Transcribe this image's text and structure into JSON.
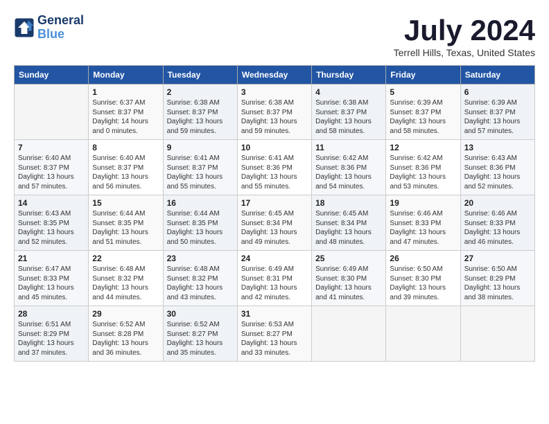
{
  "header": {
    "logo_line1": "General",
    "logo_line2": "Blue",
    "month_year": "July 2024",
    "location": "Terrell Hills, Texas, United States"
  },
  "days_of_week": [
    "Sunday",
    "Monday",
    "Tuesday",
    "Wednesday",
    "Thursday",
    "Friday",
    "Saturday"
  ],
  "weeks": [
    [
      {
        "day": "",
        "info": ""
      },
      {
        "day": "1",
        "info": "Sunrise: 6:37 AM\nSunset: 8:37 PM\nDaylight: 14 hours\nand 0 minutes."
      },
      {
        "day": "2",
        "info": "Sunrise: 6:38 AM\nSunset: 8:37 PM\nDaylight: 13 hours\nand 59 minutes."
      },
      {
        "day": "3",
        "info": "Sunrise: 6:38 AM\nSunset: 8:37 PM\nDaylight: 13 hours\nand 59 minutes."
      },
      {
        "day": "4",
        "info": "Sunrise: 6:38 AM\nSunset: 8:37 PM\nDaylight: 13 hours\nand 58 minutes."
      },
      {
        "day": "5",
        "info": "Sunrise: 6:39 AM\nSunset: 8:37 PM\nDaylight: 13 hours\nand 58 minutes."
      },
      {
        "day": "6",
        "info": "Sunrise: 6:39 AM\nSunset: 8:37 PM\nDaylight: 13 hours\nand 57 minutes."
      }
    ],
    [
      {
        "day": "7",
        "info": "Sunrise: 6:40 AM\nSunset: 8:37 PM\nDaylight: 13 hours\nand 57 minutes."
      },
      {
        "day": "8",
        "info": "Sunrise: 6:40 AM\nSunset: 8:37 PM\nDaylight: 13 hours\nand 56 minutes."
      },
      {
        "day": "9",
        "info": "Sunrise: 6:41 AM\nSunset: 8:37 PM\nDaylight: 13 hours\nand 55 minutes."
      },
      {
        "day": "10",
        "info": "Sunrise: 6:41 AM\nSunset: 8:36 PM\nDaylight: 13 hours\nand 55 minutes."
      },
      {
        "day": "11",
        "info": "Sunrise: 6:42 AM\nSunset: 8:36 PM\nDaylight: 13 hours\nand 54 minutes."
      },
      {
        "day": "12",
        "info": "Sunrise: 6:42 AM\nSunset: 8:36 PM\nDaylight: 13 hours\nand 53 minutes."
      },
      {
        "day": "13",
        "info": "Sunrise: 6:43 AM\nSunset: 8:36 PM\nDaylight: 13 hours\nand 52 minutes."
      }
    ],
    [
      {
        "day": "14",
        "info": "Sunrise: 6:43 AM\nSunset: 8:35 PM\nDaylight: 13 hours\nand 52 minutes."
      },
      {
        "day": "15",
        "info": "Sunrise: 6:44 AM\nSunset: 8:35 PM\nDaylight: 13 hours\nand 51 minutes."
      },
      {
        "day": "16",
        "info": "Sunrise: 6:44 AM\nSunset: 8:35 PM\nDaylight: 13 hours\nand 50 minutes."
      },
      {
        "day": "17",
        "info": "Sunrise: 6:45 AM\nSunset: 8:34 PM\nDaylight: 13 hours\nand 49 minutes."
      },
      {
        "day": "18",
        "info": "Sunrise: 6:45 AM\nSunset: 8:34 PM\nDaylight: 13 hours\nand 48 minutes."
      },
      {
        "day": "19",
        "info": "Sunrise: 6:46 AM\nSunset: 8:33 PM\nDaylight: 13 hours\nand 47 minutes."
      },
      {
        "day": "20",
        "info": "Sunrise: 6:46 AM\nSunset: 8:33 PM\nDaylight: 13 hours\nand 46 minutes."
      }
    ],
    [
      {
        "day": "21",
        "info": "Sunrise: 6:47 AM\nSunset: 8:33 PM\nDaylight: 13 hours\nand 45 minutes."
      },
      {
        "day": "22",
        "info": "Sunrise: 6:48 AM\nSunset: 8:32 PM\nDaylight: 13 hours\nand 44 minutes."
      },
      {
        "day": "23",
        "info": "Sunrise: 6:48 AM\nSunset: 8:32 PM\nDaylight: 13 hours\nand 43 minutes."
      },
      {
        "day": "24",
        "info": "Sunrise: 6:49 AM\nSunset: 8:31 PM\nDaylight: 13 hours\nand 42 minutes."
      },
      {
        "day": "25",
        "info": "Sunrise: 6:49 AM\nSunset: 8:30 PM\nDaylight: 13 hours\nand 41 minutes."
      },
      {
        "day": "26",
        "info": "Sunrise: 6:50 AM\nSunset: 8:30 PM\nDaylight: 13 hours\nand 39 minutes."
      },
      {
        "day": "27",
        "info": "Sunrise: 6:50 AM\nSunset: 8:29 PM\nDaylight: 13 hours\nand 38 minutes."
      }
    ],
    [
      {
        "day": "28",
        "info": "Sunrise: 6:51 AM\nSunset: 8:29 PM\nDaylight: 13 hours\nand 37 minutes."
      },
      {
        "day": "29",
        "info": "Sunrise: 6:52 AM\nSunset: 8:28 PM\nDaylight: 13 hours\nand 36 minutes."
      },
      {
        "day": "30",
        "info": "Sunrise: 6:52 AM\nSunset: 8:27 PM\nDaylight: 13 hours\nand 35 minutes."
      },
      {
        "day": "31",
        "info": "Sunrise: 6:53 AM\nSunset: 8:27 PM\nDaylight: 13 hours\nand 33 minutes."
      },
      {
        "day": "",
        "info": ""
      },
      {
        "day": "",
        "info": ""
      },
      {
        "day": "",
        "info": ""
      }
    ]
  ]
}
